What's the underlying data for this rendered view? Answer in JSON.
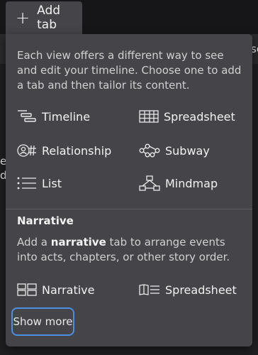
{
  "add_tab": {
    "label": "Add tab"
  },
  "background": {
    "frag_right": "sc",
    "frag_left_1": "e",
    "frag_left_2": "d"
  },
  "popover": {
    "intro": "Each view offers a different way to see and edit your timeline. Choose one to add a tab and then tailor its content.",
    "views": {
      "timeline": "Timeline",
      "spreadsheet": "Spreadsheet",
      "relationship": "Relationship",
      "subway": "Subway",
      "list": "List",
      "mindmap": "Mindmap"
    },
    "narrative": {
      "title": "Narrative",
      "desc_prefix": "Add a ",
      "desc_bold": "narrative",
      "desc_suffix": " tab to arrange events into acts, chapters, or other story order.",
      "narrative_option": "Narrative",
      "spreadsheet_option": "Spreadsheet"
    },
    "show_more": "Show more"
  },
  "colors": {
    "popover_bg": "#454549",
    "focus_ring": "#4a90e2"
  }
}
